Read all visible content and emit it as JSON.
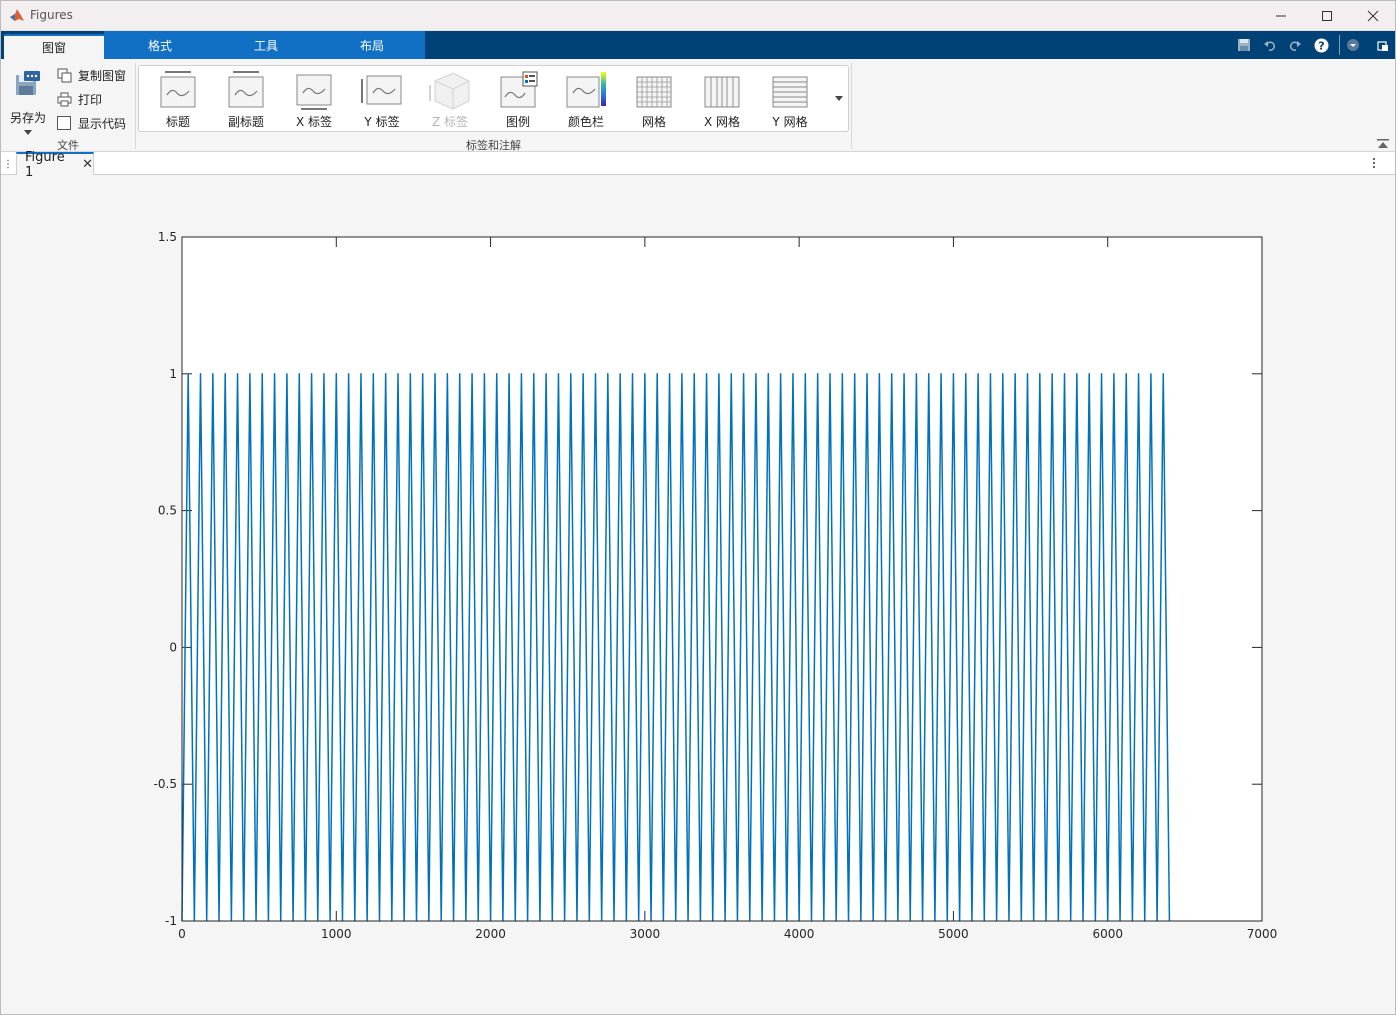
{
  "window": {
    "title": "Figures"
  },
  "ribbon_tabs": [
    {
      "label": "图窗",
      "active": true
    },
    {
      "label": "格式",
      "active": false
    },
    {
      "label": "工具",
      "active": false
    },
    {
      "label": "布局",
      "active": false
    }
  ],
  "file_group": {
    "save_as_label": "另存为",
    "copy_figure_label": "复制图窗",
    "print_label": "打印",
    "show_code_label": "显示代码",
    "group_label": "文件"
  },
  "annotation_group": {
    "group_label": "标签和注解",
    "items": [
      {
        "label": "标题",
        "icon": "title-icon",
        "enabled": true
      },
      {
        "label": "副标题",
        "icon": "subtitle-icon",
        "enabled": true
      },
      {
        "label": "X 标签",
        "icon": "xlabel-icon",
        "enabled": true
      },
      {
        "label": "Y 标签",
        "icon": "ylabel-icon",
        "enabled": true
      },
      {
        "label": "Z 标签",
        "icon": "zlabel-icon",
        "enabled": false
      },
      {
        "label": "图例",
        "icon": "legend-icon",
        "enabled": true
      },
      {
        "label": "颜色栏",
        "icon": "colorbar-icon",
        "enabled": true
      },
      {
        "label": "网格",
        "icon": "grid-icon",
        "enabled": true
      },
      {
        "label": "X 网格",
        "icon": "xgrid-icon",
        "enabled": true
      },
      {
        "label": "Y 网格",
        "icon": "ygrid-icon",
        "enabled": true
      }
    ]
  },
  "document_tab": {
    "label": "Figure 1"
  },
  "colors": {
    "line": "#0072bd",
    "tabstrip": "#004275",
    "tab_blue": "#1170c4"
  },
  "chart_data": {
    "type": "line",
    "title": "",
    "xlabel": "",
    "ylabel": "",
    "xlim": [
      0,
      7000
    ],
    "ylim": [
      -1,
      1.5
    ],
    "xticks": [
      0,
      1000,
      2000,
      3000,
      4000,
      5000,
      6000,
      7000
    ],
    "yticks": [
      -1,
      -0.5,
      0,
      0.5,
      1,
      1.5
    ],
    "ytick_labels": [
      "-1",
      "-0.5",
      "0",
      "0.5",
      "1",
      "1.5"
    ],
    "xtick_labels": [
      "0",
      "1000",
      "2000",
      "3000",
      "4000",
      "5000",
      "6000",
      "7000"
    ],
    "grid": false,
    "series": [
      {
        "description": "triangle wave oscillating between -1 and 1",
        "period": 80,
        "start_x": 0,
        "end_x": 6400,
        "end_y": 0.65,
        "min": -1,
        "max": 1
      }
    ]
  }
}
